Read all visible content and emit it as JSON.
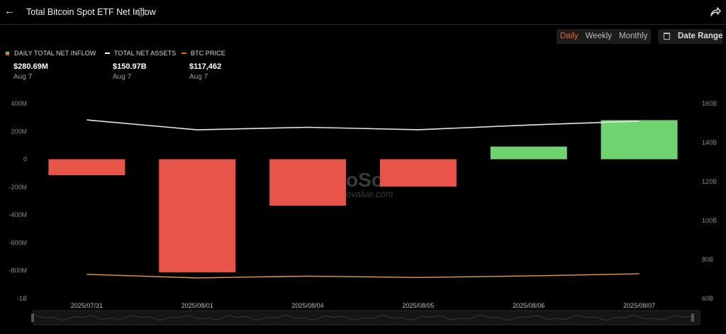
{
  "header": {
    "title": "Total Bitcoin Spot ETF Net Inflow",
    "info_glyph": "i",
    "back_glyph": "←"
  },
  "range_tabs": [
    {
      "label": "Daily",
      "active": true
    },
    {
      "label": "Weekly",
      "active": false
    },
    {
      "label": "Monthly",
      "active": false
    }
  ],
  "date_range_label": "Date Range",
  "legend": [
    {
      "label": "DAILY TOTAL NET INFLOW",
      "value": "$280.69M",
      "date": "Aug 7"
    },
    {
      "label": "TOTAL NET ASSETS",
      "value": "$150.97B",
      "date": "Aug 7",
      "color": "#ffffff"
    },
    {
      "label": "BTC PRICE",
      "value": "$117,462",
      "date": "Aug 7",
      "color": "#e8682b"
    }
  ],
  "watermark": {
    "big": "oSo",
    "small": "ovalue.com"
  },
  "colors": {
    "positive": "#6fd36f",
    "negative": "#e8544a",
    "assets_line": "#e6e6e6",
    "price_line": "#e8a030",
    "accent": "#e8682b"
  },
  "chart_data": {
    "type": "bar",
    "categories": [
      "2025/07/31",
      "2025/08/01",
      "2025/08/04",
      "2025/08/05",
      "2025/08/06",
      "2025/08/07"
    ],
    "series": [
      {
        "name": "DAILY TOTAL NET INFLOW",
        "type": "bar",
        "axis": "left",
        "values": [
          -114.0,
          -812.0,
          -333.0,
          -196.0,
          91.0,
          280.69
        ]
      },
      {
        "name": "TOTAL NET ASSETS",
        "type": "line",
        "axis": "right",
        "values": [
          151.6,
          146.5,
          147.8,
          146.6,
          149.0,
          150.97
        ]
      },
      {
        "name": "BTC PRICE",
        "type": "line",
        "axis": "right-scaled",
        "values": [
          72.4,
          70.6,
          71.5,
          70.8,
          71.6,
          72.7
        ]
      }
    ],
    "y_left": {
      "ticks": [
        "400M",
        "200M",
        "0",
        "-200M",
        "-400M",
        "-600M",
        "-800M",
        "-1B"
      ],
      "range": [
        -1000,
        400
      ]
    },
    "y_right": {
      "ticks": [
        "160B",
        "140B",
        "120B",
        "100B",
        "80B",
        "60B"
      ],
      "range": [
        60,
        160
      ]
    },
    "grid": false,
    "legend_position": "top-left"
  }
}
